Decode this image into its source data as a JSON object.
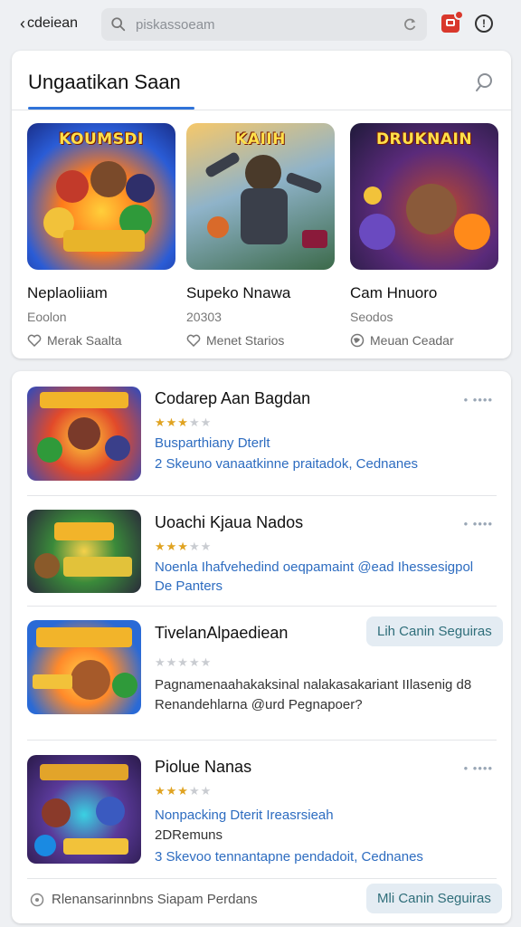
{
  "topbar": {
    "back_label": "cdeiean",
    "search_placeholder": "piskassoeam",
    "colors": {
      "notification": "#d9382c"
    }
  },
  "featured": {
    "title": "Ungaatikan Saan",
    "items": [
      {
        "art_label": "KOUMSDI",
        "name": "Neplaoliiam",
        "sub": "Eoolon",
        "meta": "Merak Saalta",
        "meta_icon": "heart-icon"
      },
      {
        "art_label": "KAIIH",
        "name": "Supeko Nnawa",
        "sub": "20303",
        "meta": "Menet Starios",
        "meta_icon": "heart-icon"
      },
      {
        "art_label": "DRUKNAIN",
        "name": "Cam Hnuoro",
        "sub": "Seodos",
        "meta": "Meuan Ceadar",
        "meta_icon": "globe-icon"
      }
    ]
  },
  "list": {
    "items": [
      {
        "title": "Codarep Aan Bagdan",
        "rating": 3,
        "line1": "Busparthiany Dterlt",
        "line2": "2 Skeuno vanaatkinne praitadok, Cednanes",
        "more": "• ••••"
      },
      {
        "title": "Uoachi Kjaua Nados",
        "rating": 3,
        "line1": "Noenla Ihafvehedind oeqpamaint @ead Ihessesigpol",
        "line2": "De Panters",
        "more": "• ••••"
      },
      {
        "title": "TivelanAlpaediean",
        "rating": 0,
        "line1": "Pagnamenaahakaksinal nalakasakariant IIlasenig d8",
        "line2": "Renandehlarna @urd Pegnapoer?",
        "button": "Lih Canin Seguiras"
      },
      {
        "title": "Piolue Nanas",
        "rating": 3,
        "line1": "Nonpacking Dterit Ireasrsieah",
        "line2": "2DRemuns",
        "line3": "3 Skevoo tennantapne pendadoit, Cednanes",
        "more": "• ••••"
      }
    ],
    "footer_text": "Rlenansarinnbns Siapam Perdans",
    "footer_button": "Mli Canin Seguiras"
  }
}
